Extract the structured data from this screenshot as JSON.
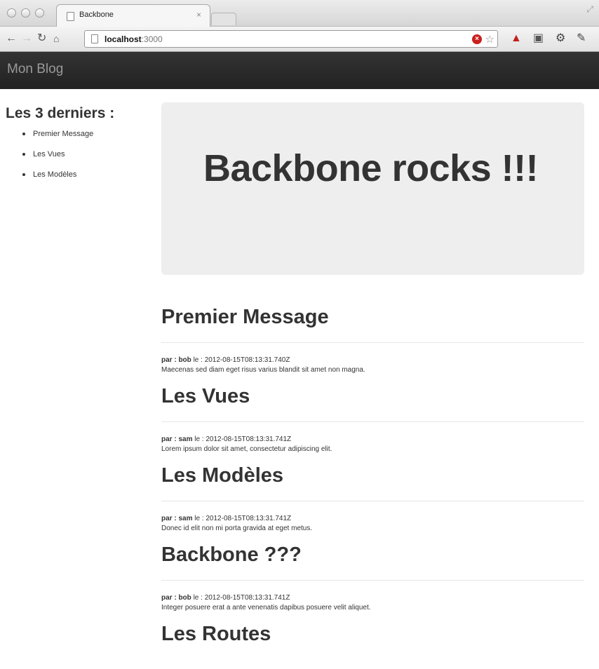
{
  "browser": {
    "tab_title": "Backbone",
    "tab_close": "×",
    "url_host": "localhost",
    "url_port": ":3000"
  },
  "navbar": {
    "brand": "Mon Blog"
  },
  "sidebar": {
    "title": "Les 3 derniers :",
    "items": [
      {
        "label": "Premier Message"
      },
      {
        "label": "Les Vues"
      },
      {
        "label": "Les Modèles"
      }
    ]
  },
  "hero": {
    "title": "Backbone rocks !!!"
  },
  "posts": [
    {
      "title": "Premier Message",
      "by_label": "par :",
      "author": "bob",
      "date_label": "le :",
      "date": "2012-08-15T08:13:31.740Z",
      "body": "Maecenas sed diam eget risus varius blandit sit amet non magna."
    },
    {
      "title": "Les Vues",
      "by_label": "par :",
      "author": "sam",
      "date_label": "le :",
      "date": "2012-08-15T08:13:31.741Z",
      "body": "Lorem ipsum dolor sit amet, consectetur adipiscing elit."
    },
    {
      "title": "Les Modèles",
      "by_label": "par :",
      "author": "sam",
      "date_label": "le :",
      "date": "2012-08-15T08:13:31.741Z",
      "body": "Donec id elit non mi porta gravida at eget metus."
    },
    {
      "title": "Backbone ???",
      "by_label": "par :",
      "author": "bob",
      "date_label": "le :",
      "date": "2012-08-15T08:13:31.741Z",
      "body": "Integer posuere erat a ante venenatis dapibus posuere velit aliquet."
    },
    {
      "title": "Les Routes",
      "by_label": "",
      "author": "",
      "date_label": "",
      "date": "",
      "body": ""
    }
  ]
}
